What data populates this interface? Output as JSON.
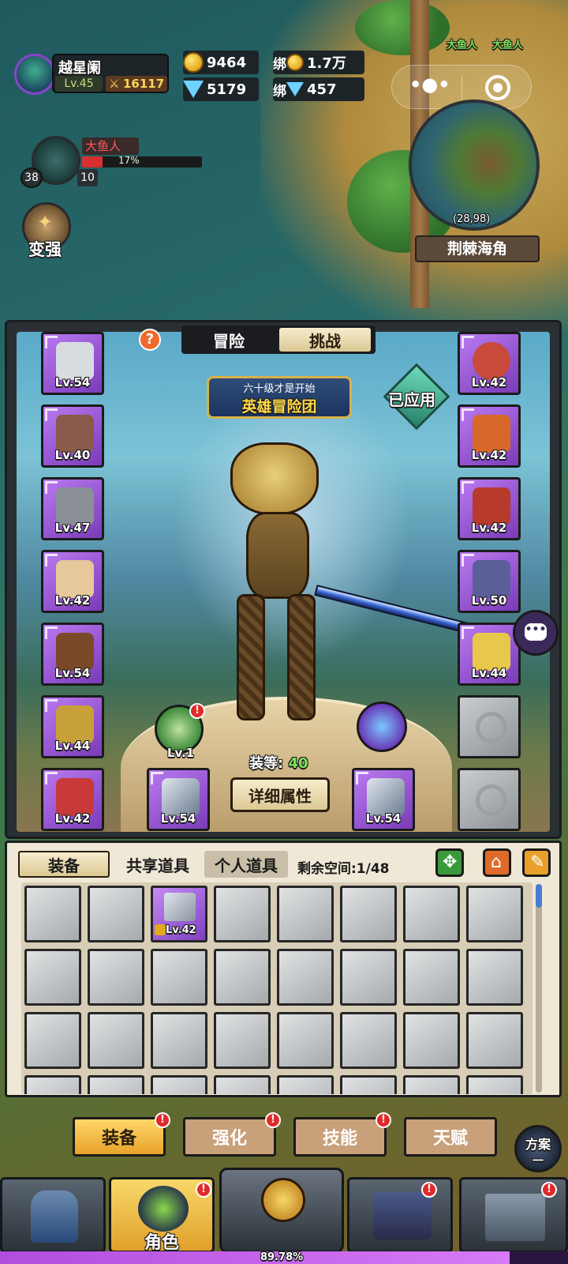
{
  "player": {
    "name": "越星阑",
    "level": "Lv.45",
    "power": "16117"
  },
  "resources": {
    "gold": "9464",
    "bound_gold": "1.7万",
    "diamond": "5179",
    "bound_diamond": "457",
    "bound_label": "绑"
  },
  "boss": {
    "name": "大鱼人",
    "percent": "17%",
    "percent_value": 17,
    "left_num": "38",
    "right_num": "10"
  },
  "strengthen_label": "变强",
  "minimap": {
    "location": "荆棘海角",
    "coords": "(28,98)",
    "enemy_labels": [
      "大鱼人",
      "大鱼人"
    ]
  },
  "panel": {
    "tabs": [
      "冒险",
      "挑战"
    ],
    "active_tab": "挑战",
    "help": "?",
    "banner_top": "六十级才是开始",
    "banner_main": "英雄冒险团",
    "applied": "已应用",
    "gear_score_label": "装等:",
    "gear_score": "40",
    "detail_button": "详细属性",
    "pet_level": "Lv.1",
    "left_slots": [
      "Lv.54",
      "Lv.40",
      "Lv.47",
      "Lv.42",
      "Lv.54",
      "Lv.44",
      "Lv.42"
    ],
    "right_slots": [
      "Lv.42",
      "Lv.42",
      "Lv.42",
      "Lv.50",
      "Lv.44"
    ],
    "weapon_left": "Lv.54",
    "weapon_right": "Lv.54"
  },
  "inventory": {
    "tabs": [
      "装备",
      "共享道具",
      "个人道具"
    ],
    "space_label": "剩余空间:1/48",
    "item_level": "Lv.42"
  },
  "subtabs": [
    "装备",
    "强化",
    "技能",
    "天赋"
  ],
  "scheme": {
    "line1": "方案",
    "line2": "一"
  },
  "nav": {
    "active_label": "角色"
  },
  "exp": {
    "percent": "89.78%",
    "value": 89.78
  },
  "badge": "!",
  "colors": {
    "gold": "#e3a91a",
    "purple": "#8040c0",
    "red_badge": "#e02a2a",
    "beige": "#f0e8d6"
  }
}
